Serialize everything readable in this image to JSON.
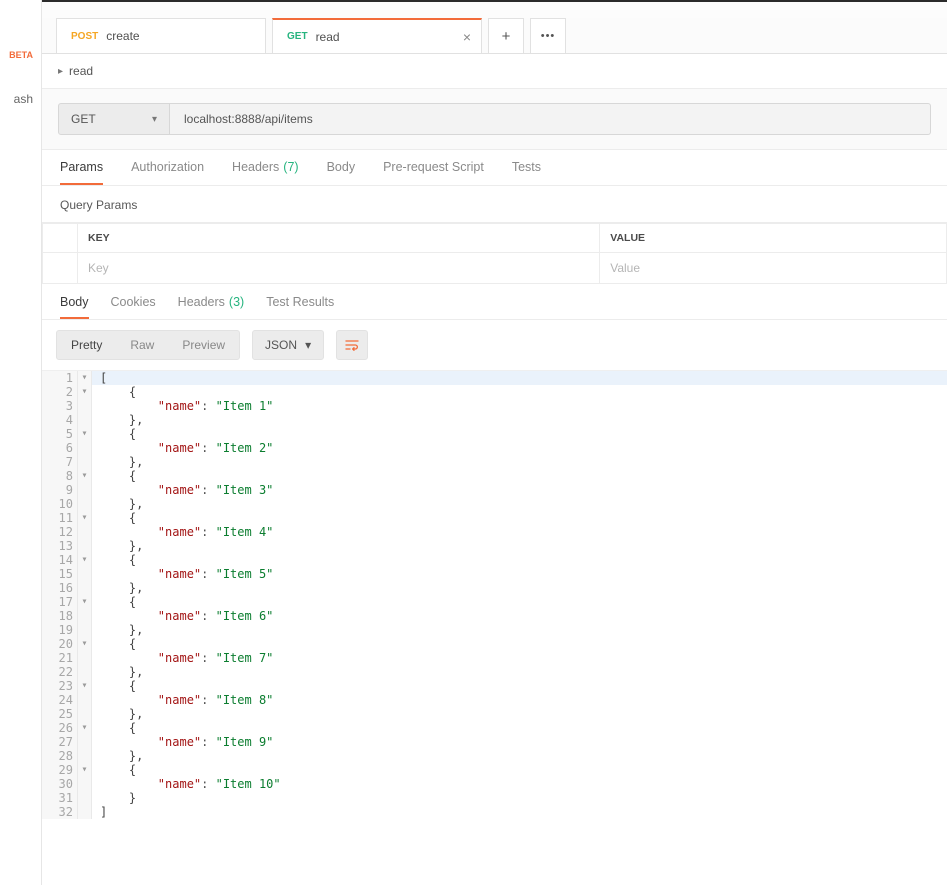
{
  "sidebar": {
    "beta": "BETA",
    "trash": "ash"
  },
  "tabs": {
    "tab0": {
      "method": "POST",
      "label": "create"
    },
    "tab1": {
      "method": "GET",
      "label": "read"
    },
    "close_glyph": "×",
    "plus_glyph": "+",
    "dots_glyph": "•••"
  },
  "breadcrumb": {
    "caret": "▸",
    "name": "read"
  },
  "request": {
    "method": "GET",
    "chevron": "▾",
    "url": "localhost:8888/api/items"
  },
  "req_tabs": {
    "params": "Params",
    "auth": "Authorization",
    "headers": "Headers",
    "headers_count": "(7)",
    "body": "Body",
    "prerequest": "Pre-request Script",
    "tests": "Tests"
  },
  "params_section": {
    "title": "Query Params",
    "key_header": "KEY",
    "value_header": "VALUE",
    "key_placeholder": "Key",
    "value_placeholder": "Value"
  },
  "resp_tabs": {
    "body": "Body",
    "cookies": "Cookies",
    "headers": "Headers",
    "headers_count": "(3)",
    "tests": "Test Results"
  },
  "view": {
    "pretty": "Pretty",
    "raw": "Raw",
    "preview": "Preview",
    "lang": "JSON",
    "lang_chevron": "▾"
  },
  "response_body": [
    {
      "n": 1,
      "fold": "▾",
      "s": "[",
      "hl": true
    },
    {
      "n": 2,
      "fold": "▾",
      "s": "    {"
    },
    {
      "n": 3,
      "fold": "",
      "kv": {
        "indent": "        ",
        "key": "\"name\"",
        "colon": ": ",
        "val": "\"Item 1\""
      }
    },
    {
      "n": 4,
      "fold": "",
      "s": "    },"
    },
    {
      "n": 5,
      "fold": "▾",
      "s": "    {"
    },
    {
      "n": 6,
      "fold": "",
      "kv": {
        "indent": "        ",
        "key": "\"name\"",
        "colon": ": ",
        "val": "\"Item 2\""
      }
    },
    {
      "n": 7,
      "fold": "",
      "s": "    },"
    },
    {
      "n": 8,
      "fold": "▾",
      "s": "    {"
    },
    {
      "n": 9,
      "fold": "",
      "kv": {
        "indent": "        ",
        "key": "\"name\"",
        "colon": ": ",
        "val": "\"Item 3\""
      }
    },
    {
      "n": 10,
      "fold": "",
      "s": "    },"
    },
    {
      "n": 11,
      "fold": "▾",
      "s": "    {"
    },
    {
      "n": 12,
      "fold": "",
      "kv": {
        "indent": "        ",
        "key": "\"name\"",
        "colon": ": ",
        "val": "\"Item 4\""
      }
    },
    {
      "n": 13,
      "fold": "",
      "s": "    },"
    },
    {
      "n": 14,
      "fold": "▾",
      "s": "    {"
    },
    {
      "n": 15,
      "fold": "",
      "kv": {
        "indent": "        ",
        "key": "\"name\"",
        "colon": ": ",
        "val": "\"Item 5\""
      }
    },
    {
      "n": 16,
      "fold": "",
      "s": "    },"
    },
    {
      "n": 17,
      "fold": "▾",
      "s": "    {"
    },
    {
      "n": 18,
      "fold": "",
      "kv": {
        "indent": "        ",
        "key": "\"name\"",
        "colon": ": ",
        "val": "\"Item 6\""
      }
    },
    {
      "n": 19,
      "fold": "",
      "s": "    },"
    },
    {
      "n": 20,
      "fold": "▾",
      "s": "    {"
    },
    {
      "n": 21,
      "fold": "",
      "kv": {
        "indent": "        ",
        "key": "\"name\"",
        "colon": ": ",
        "val": "\"Item 7\""
      }
    },
    {
      "n": 22,
      "fold": "",
      "s": "    },"
    },
    {
      "n": 23,
      "fold": "▾",
      "s": "    {"
    },
    {
      "n": 24,
      "fold": "",
      "kv": {
        "indent": "        ",
        "key": "\"name\"",
        "colon": ": ",
        "val": "\"Item 8\""
      }
    },
    {
      "n": 25,
      "fold": "",
      "s": "    },"
    },
    {
      "n": 26,
      "fold": "▾",
      "s": "    {"
    },
    {
      "n": 27,
      "fold": "",
      "kv": {
        "indent": "        ",
        "key": "\"name\"",
        "colon": ": ",
        "val": "\"Item 9\""
      }
    },
    {
      "n": 28,
      "fold": "",
      "s": "    },"
    },
    {
      "n": 29,
      "fold": "▾",
      "s": "    {"
    },
    {
      "n": 30,
      "fold": "",
      "kv": {
        "indent": "        ",
        "key": "\"name\"",
        "colon": ": ",
        "val": "\"Item 10\""
      }
    },
    {
      "n": 31,
      "fold": "",
      "s": "    }"
    },
    {
      "n": 32,
      "fold": "",
      "s": "]"
    }
  ]
}
